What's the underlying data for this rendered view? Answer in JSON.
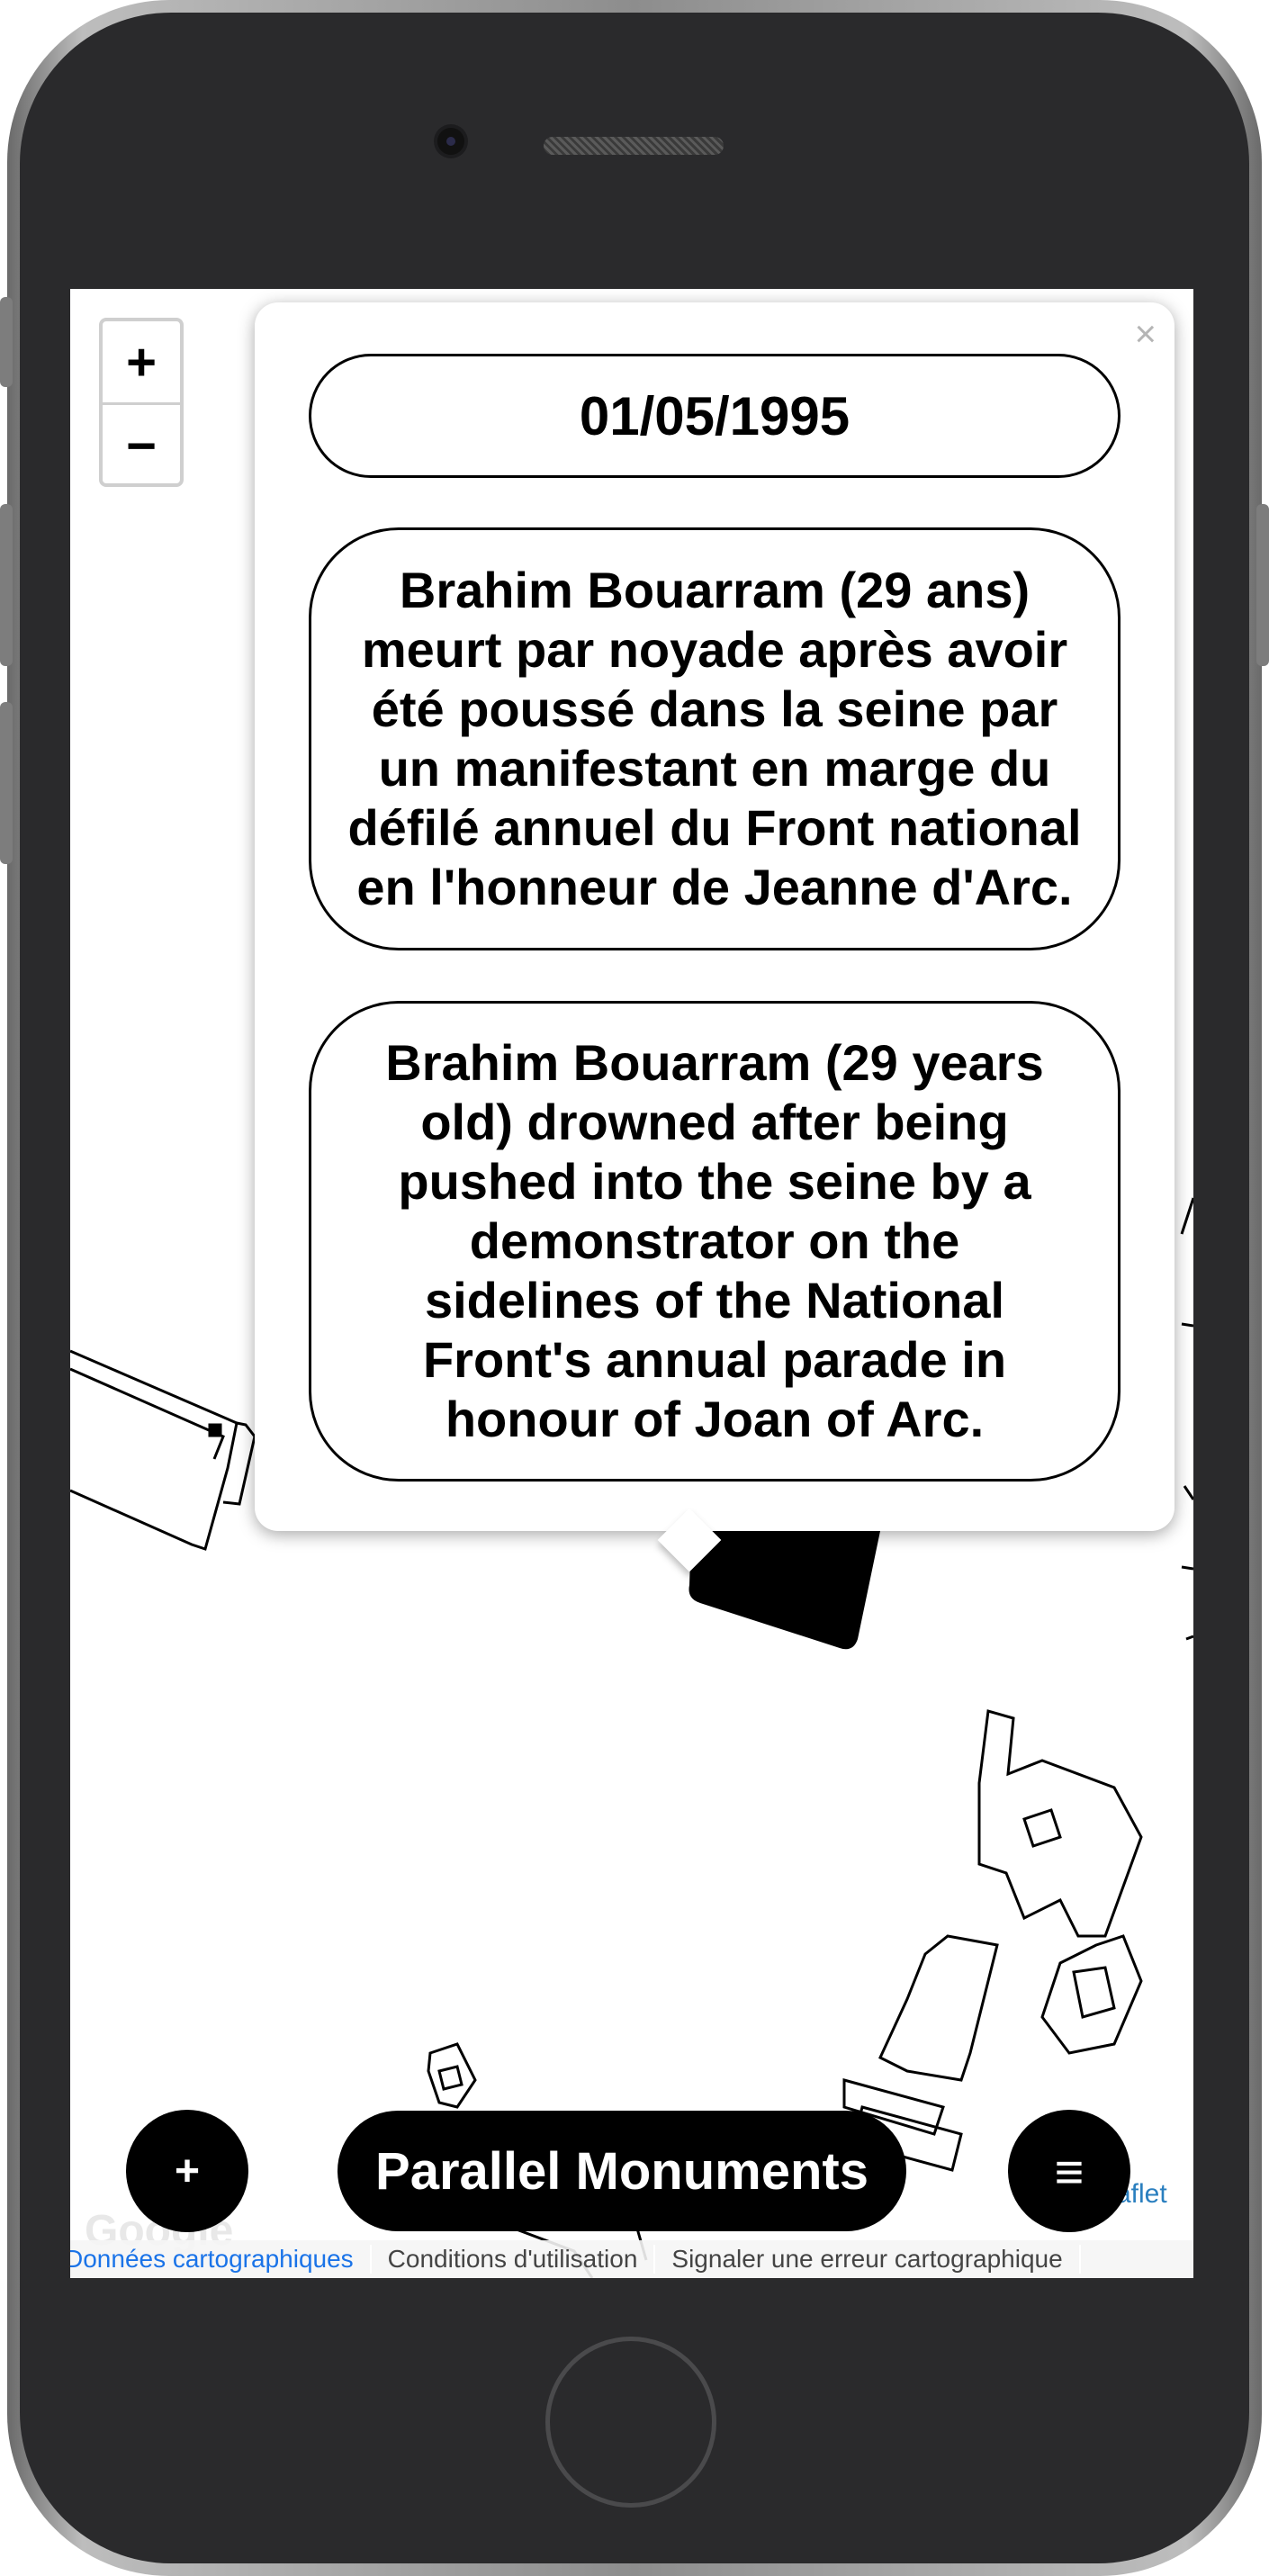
{
  "map": {
    "zoom_in_label": "+",
    "zoom_out_label": "−"
  },
  "popup": {
    "close_label": "×",
    "date": "01/05/1995",
    "text_fr": "Brahim Bouarram (29 ans) meurt par noyade après avoir été poussé dans la seine par un manifestant en marge du défilé annuel du Front national en l'honneur de Jeanne d'Arc.",
    "text_en": "Brahim Bouarram (29 years old) drowned after being pushed into the seine by a demonstrator on the sidelines of the National Front's annual parade in honour of Joan of Arc."
  },
  "bottom_bar": {
    "add_label": "+",
    "title": "Parallel Monuments",
    "menu_label": "≡"
  },
  "attribution": {
    "google": "Google",
    "leaflet": "aflet",
    "map_data": "Données cartographiques",
    "terms": "Conditions d'utilisation",
    "report": "Signaler une erreur cartographique"
  }
}
